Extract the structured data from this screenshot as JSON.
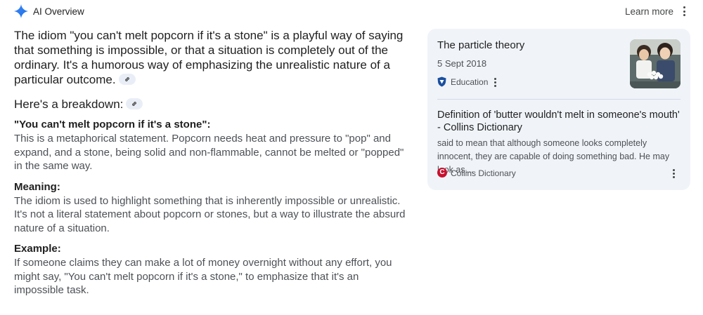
{
  "header": {
    "title": "AI Overview",
    "learn_more": "Learn more"
  },
  "overview": {
    "lead": "The idiom \"you can't melt popcorn if it's a stone\" is a playful way of saying that something is impossible, or that a situation is completely out of the ordinary. It's a humorous way of emphasizing the unrealistic nature of a particular outcome.",
    "breakdown_heading": "Here's a breakdown:",
    "sections": [
      {
        "label": "\"You can't melt popcorn if it's a stone\":",
        "text": "This is a metaphorical statement. Popcorn needs heat and pressure to \"pop\" and expand, and a stone, being solid and non-flammable, cannot be melted or \"popped\" in the same way."
      },
      {
        "label": "Meaning:",
        "text": "The idiom is used to highlight something that is inherently impossible or unrealistic. It's not a literal statement about popcorn or stones, but a way to illustrate the absurd nature of a situation."
      },
      {
        "label": "Example:",
        "text": "If someone claims they can make a lot of money overnight without any effort, you might say, \"You can't melt popcorn if it's a stone,\" to emphasize that it's an impossible task."
      }
    ]
  },
  "sources": [
    {
      "title": "The particle theory",
      "date": "5 Sept 2018",
      "site": "Education",
      "icon": "education-shield-icon"
    },
    {
      "title": "Definition of 'butter wouldn't melt in someone's mouth' - Collins Dictionary",
      "snippet": "said to mean that although someone looks completely innocent, they are capable of doing something bad. He may look as…",
      "site": "Collins Dictionary",
      "icon_letter": "C",
      "icon_color": "#c8102e"
    }
  ],
  "colors": {
    "accent": "#4285f4",
    "card_bg": "#f0f4f9",
    "chip_bg": "#e9eef6"
  }
}
